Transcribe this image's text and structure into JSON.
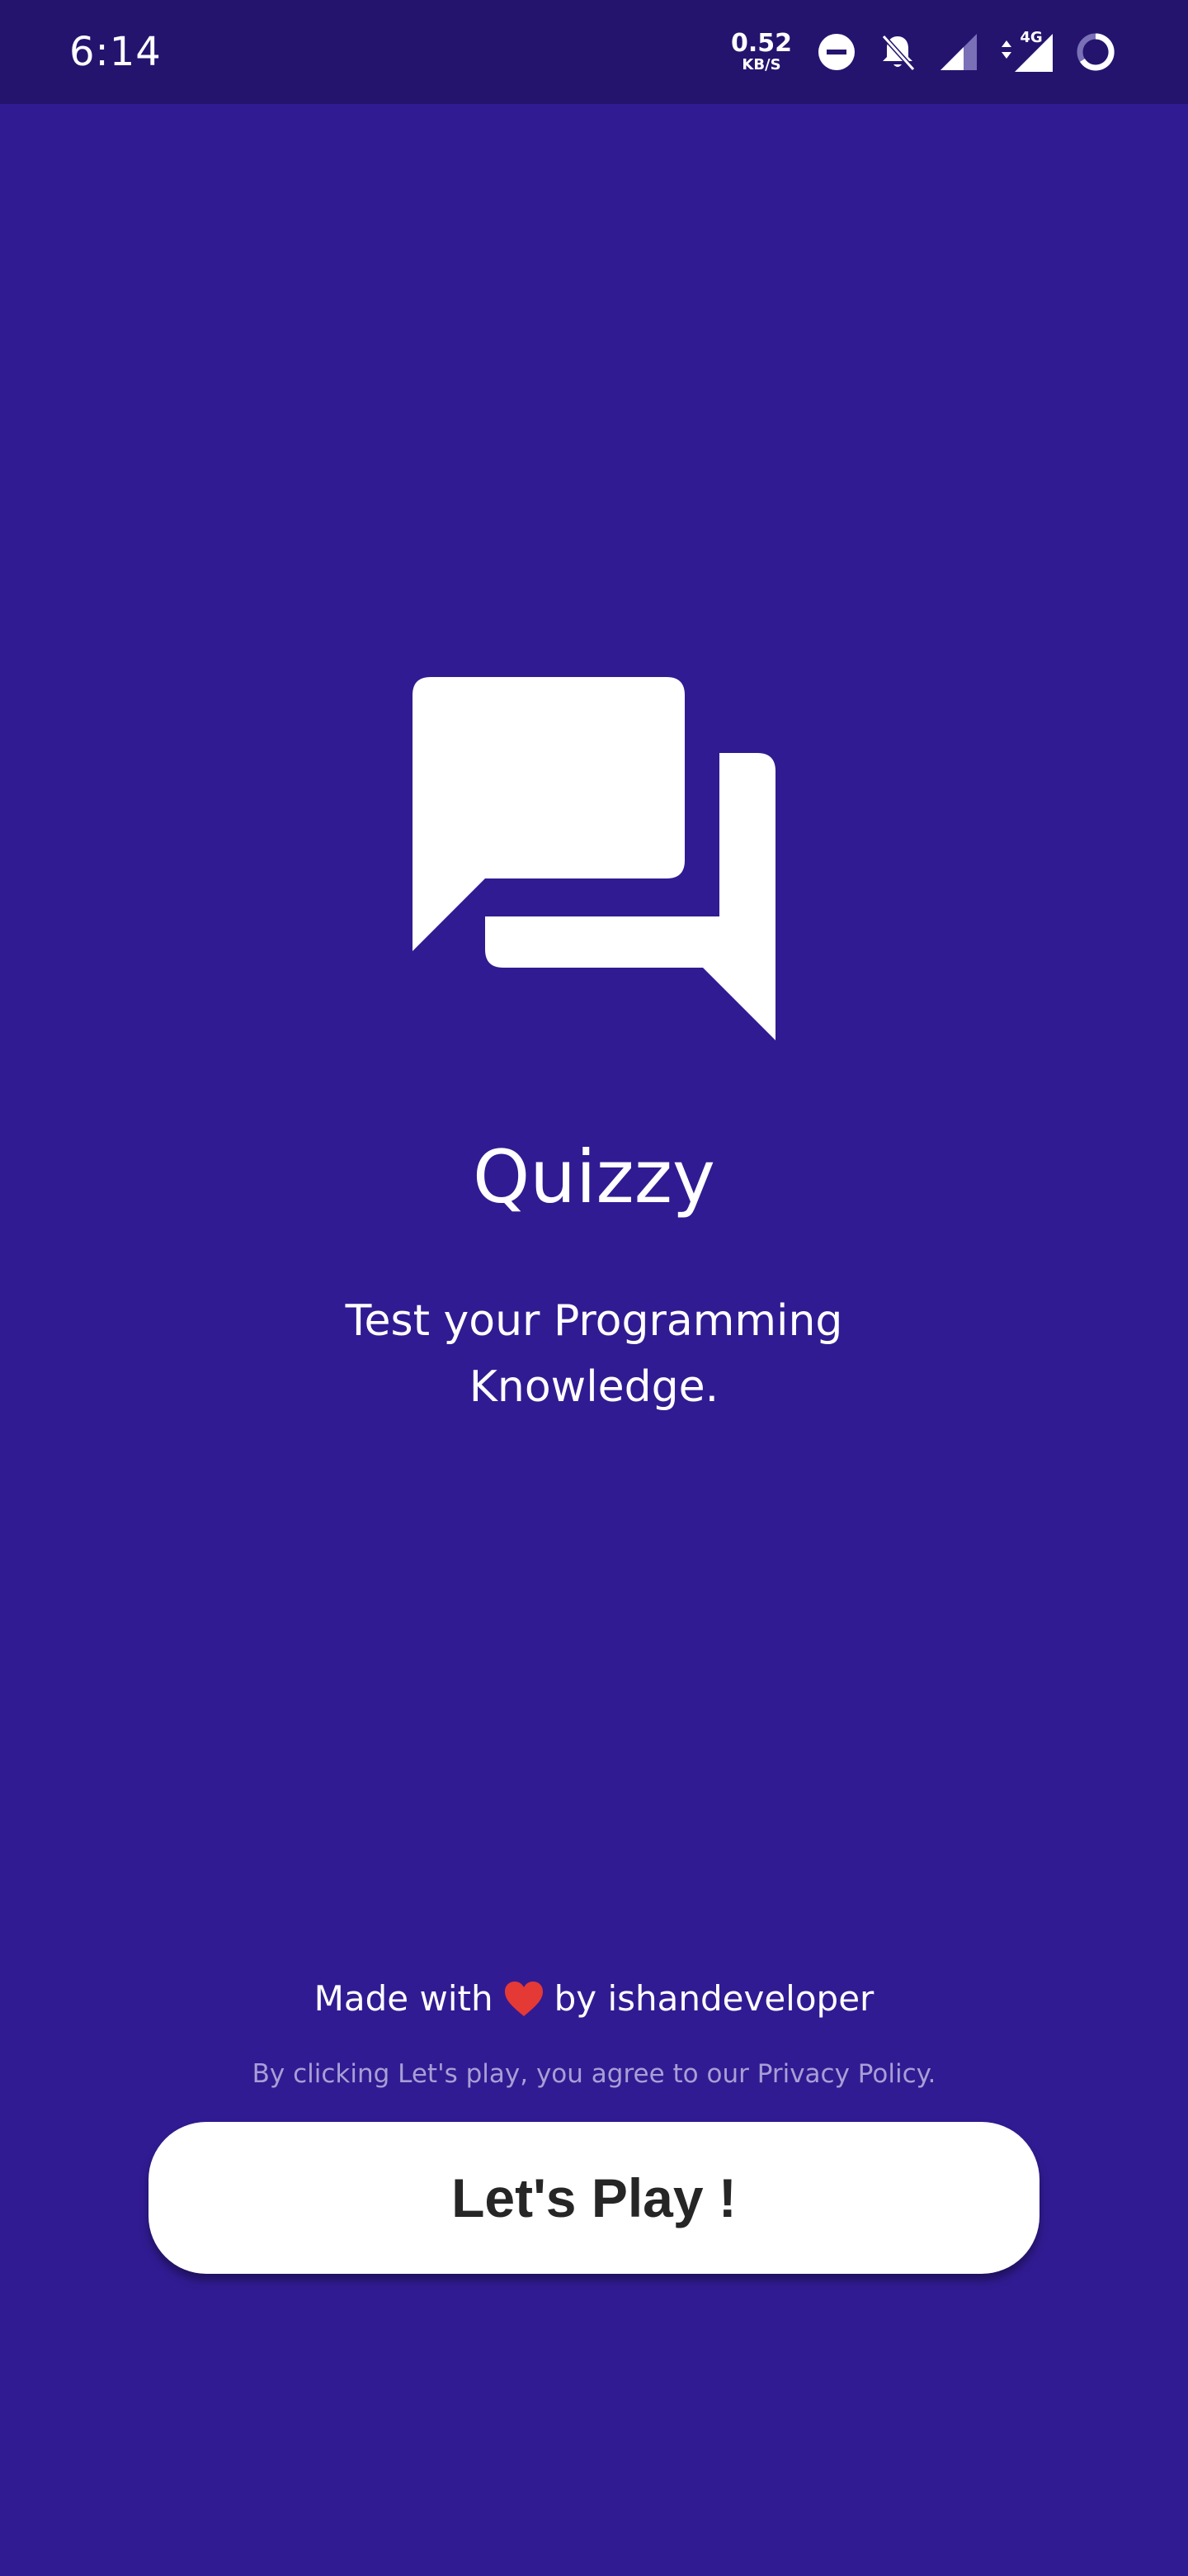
{
  "status_bar": {
    "time": "6:14",
    "net_speed_value": "0.52",
    "net_speed_unit": "KB/S",
    "network_label": "4G",
    "icons": [
      "do-not-disturb-icon",
      "bell-off-icon",
      "signal-icon",
      "signal-4g-icon",
      "loading-icon"
    ]
  },
  "app": {
    "title": "Quizzy",
    "tagline": "Test your Programming Knowledge.",
    "logo_icon": "chat-bubbles-icon",
    "credits_prefix": "Made with",
    "credits_suffix": "by ishandeveloper",
    "heart_icon": "heart-icon",
    "privacy_note": "By clicking Let's play, you agree to our Privacy Policy.",
    "play_button_label": "Let's Play !"
  },
  "colors": {
    "background": "#311b92",
    "status_bar": "#24146e",
    "button": "#ffffff",
    "button_text": "#262626",
    "heart": "#e53935",
    "privacy_text": "#a79fd6"
  }
}
